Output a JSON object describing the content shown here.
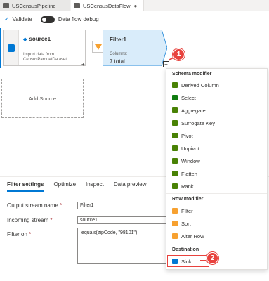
{
  "tabs": [
    {
      "label": "USCensusPipeline",
      "color": "#605e5c"
    },
    {
      "label": "USCensusDataFlow",
      "color": "#605e5c"
    }
  ],
  "toolbar": {
    "validate_label": "Validate",
    "debug_label": "Data flow debug"
  },
  "canvas": {
    "source": {
      "title": "source1",
      "desc": "Import data from CensusParquetDataset"
    },
    "filter": {
      "title": "Filter1",
      "sub_label": "Columns:",
      "total": "7 total"
    },
    "add_source": "Add Source",
    "plus": "+"
  },
  "badges": {
    "one": "1",
    "two": "2"
  },
  "panel": {
    "tabs": [
      "Filter settings",
      "Optimize",
      "Inspect",
      "Data preview"
    ],
    "output_label": "Output stream name",
    "output_value": "Filter1",
    "incoming_label": "Incoming stream",
    "incoming_value": "source1",
    "filter_label": "Filter on",
    "filter_expr": "equals(zipCode, \"98101\")",
    "required_mark": "*"
  },
  "menu": {
    "sections": [
      {
        "header": "Schema modifier",
        "items": [
          {
            "label": "Derived Column",
            "icon": "derived-column-icon",
            "color": "#498205"
          },
          {
            "label": "Select",
            "icon": "select-icon",
            "color": "#107c10"
          },
          {
            "label": "Aggregate",
            "icon": "aggregate-icon",
            "color": "#498205"
          },
          {
            "label": "Surrogate Key",
            "icon": "key-icon",
            "color": "#498205"
          },
          {
            "label": "Pivot",
            "icon": "pivot-icon",
            "color": "#498205"
          },
          {
            "label": "Unpivot",
            "icon": "unpivot-icon",
            "color": "#498205"
          },
          {
            "label": "Window",
            "icon": "window-icon",
            "color": "#498205"
          },
          {
            "label": "Flatten",
            "icon": "flatten-icon",
            "color": "#498205"
          },
          {
            "label": "Rank",
            "icon": "rank-icon",
            "color": "#498205"
          }
        ]
      },
      {
        "header": "Row modifier",
        "items": [
          {
            "label": "Filter",
            "icon": "filter-icon",
            "color": "#f7a130"
          },
          {
            "label": "Sort",
            "icon": "sort-icon",
            "color": "#f7a130"
          },
          {
            "label": "Alter Row",
            "icon": "alter-row-icon",
            "color": "#f7a130"
          }
        ]
      },
      {
        "header": "Destination",
        "items": [
          {
            "label": "Sink",
            "icon": "sink-icon",
            "color": "#0078d4"
          }
        ]
      }
    ]
  }
}
